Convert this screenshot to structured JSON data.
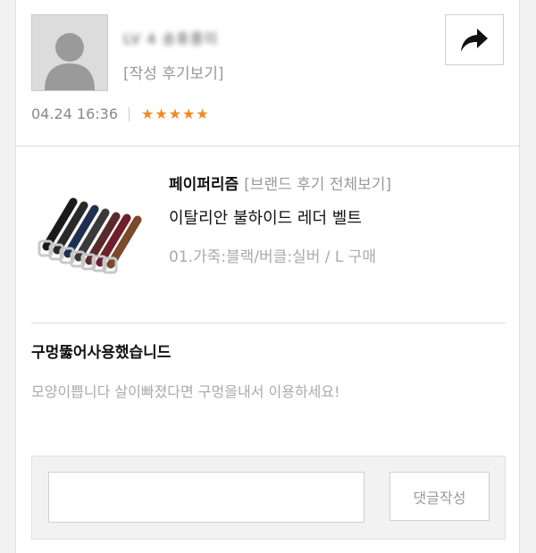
{
  "review": {
    "username": "LV 4 송휴롱미",
    "review_link": "[작성 후기보기]",
    "date": "04.24 16:36",
    "stars": "★★★★★",
    "rating": 5,
    "title": "구멍뚫어사용했습니드",
    "body": "모양이쁩니다 살이빠졌다면 구멍을내서 이용하세요!"
  },
  "product": {
    "brand": "페이퍼리즘",
    "brand_link": "[브랜드 후기 전체보기]",
    "name": "이탈리안 불하이드 레더 벨트",
    "option": "01.가죽:블랙/버클:실버 / L 구매"
  },
  "comment": {
    "placeholder": "",
    "submit_label": "댓글작성"
  },
  "icons": {
    "share": "share-arrow-icon",
    "avatar": "user-silhouette-icon"
  },
  "colors": {
    "star": "#f08a24"
  }
}
